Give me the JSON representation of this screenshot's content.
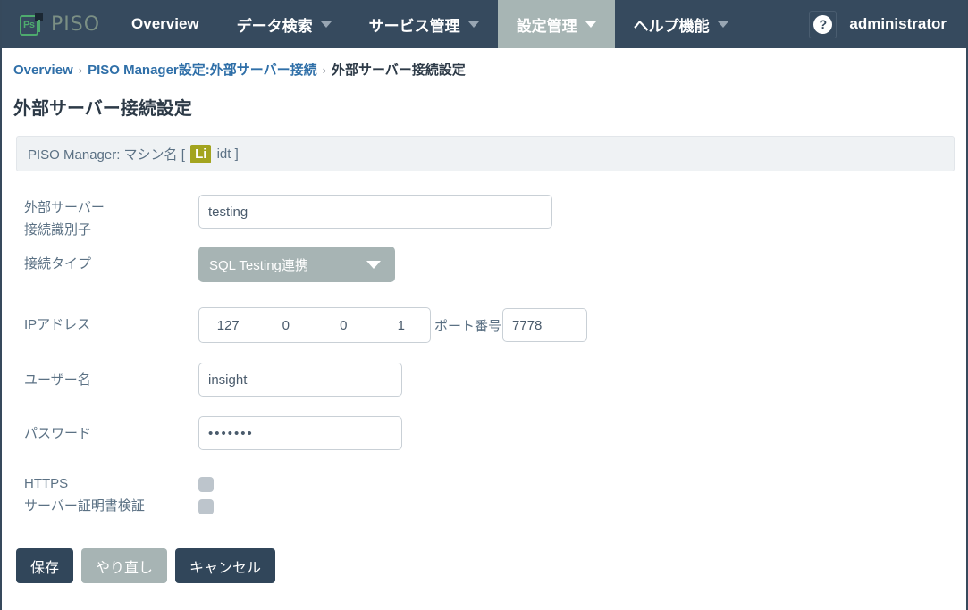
{
  "nav": {
    "brand": {
      "mark_label": "Ps",
      "text": "PISO"
    },
    "items": [
      {
        "label": "Overview",
        "has_caret": false,
        "active": false
      },
      {
        "label": "データ検索",
        "has_caret": true,
        "active": false
      },
      {
        "label": "サービス管理",
        "has_caret": true,
        "active": false
      },
      {
        "label": "設定管理",
        "has_caret": true,
        "active": true
      },
      {
        "label": "ヘルプ機能",
        "has_caret": true,
        "active": false
      }
    ],
    "help_glyph": "?",
    "user": "administrator"
  },
  "breadcrumb": {
    "first": "Overview",
    "sep1": "›",
    "second": "PISO Manager設定:外部サーバー接続",
    "sep2": "›",
    "current": "外部サーバー接続設定"
  },
  "page": {
    "title": "外部サーバー接続設定"
  },
  "info_bar": {
    "prefix": "PISO Manager: マシン名 [ ",
    "highlight": "Li",
    "suffix": " idt ]"
  },
  "form": {
    "identifier": {
      "label_line1": "外部サーバー",
      "label_line2": "接続識別子",
      "value": "testing",
      "placeholder": ""
    },
    "connection_type": {
      "label": "接続タイプ",
      "value": "SQL Testing連携"
    },
    "ip_address": {
      "label": "IPアドレス",
      "octets": [
        "127",
        "0",
        "0",
        "1"
      ]
    },
    "port": {
      "label": "ポート番号",
      "value": "7778",
      "placeholder": ""
    },
    "username": {
      "label": "ユーザー名",
      "value": "insight",
      "placeholder": ""
    },
    "password": {
      "label": "パスワード",
      "value": "•••••••",
      "placeholder": ""
    },
    "https": {
      "label": "HTTPS",
      "checked": false
    },
    "cert_verify": {
      "label": "サーバー証明書検証",
      "checked": false
    }
  },
  "buttons": {
    "save": "保存",
    "reset": "やり直し",
    "cancel": "キャンセル"
  },
  "colors": {
    "nav_bg": "#364a5e",
    "nav_active_bg": "#a7b5b4",
    "brand_green": "#4eab6e",
    "link_blue": "#2f6fa8",
    "highlight_olive": "#a3a41f",
    "button_primary": "#31465a",
    "button_disabled": "#a7b4b4",
    "label_text": "#5b7184"
  }
}
